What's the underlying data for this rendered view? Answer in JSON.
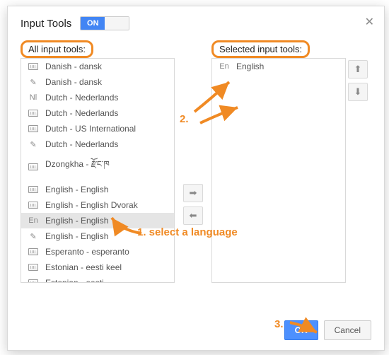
{
  "header": {
    "title": "Input Tools",
    "toggle_on": "ON"
  },
  "labels": {
    "all": "All input tools:",
    "selected": "Selected input tools:"
  },
  "all_tools": [
    {
      "icon": "kbd",
      "label": "Danish -   dansk"
    },
    {
      "icon": "pencil",
      "label": "Danish -   dansk"
    },
    {
      "icon": "nl",
      "label": "Dutch -   Nederlands"
    },
    {
      "icon": "kbd",
      "label": "Dutch -   Nederlands"
    },
    {
      "icon": "kbd",
      "label": "Dutch -   US International"
    },
    {
      "icon": "pencil",
      "label": "Dutch -   Nederlands"
    },
    {
      "icon": "kbd",
      "label": "Dzongkha -   རྫོང་ཁ"
    },
    {
      "icon": "kbd",
      "label": "English -   English"
    },
    {
      "icon": "kbd",
      "label": "English -   English Dvorak"
    },
    {
      "icon": "en",
      "label": "English -   English",
      "selected": true
    },
    {
      "icon": "pencil",
      "label": "English -   English"
    },
    {
      "icon": "kbd",
      "label": "Esperanto -   esperanto"
    },
    {
      "icon": "kbd",
      "label": "Estonian -   eesti keel"
    },
    {
      "icon": "kbd",
      "label": "Estonian -   eesti"
    }
  ],
  "selected_tools": [
    {
      "icon": "en",
      "label": "English"
    }
  ],
  "buttons": {
    "ok": "OK",
    "cancel": "Cancel"
  },
  "annotations": {
    "step1": "1. select a language",
    "step2": "2.",
    "step3": "3."
  }
}
